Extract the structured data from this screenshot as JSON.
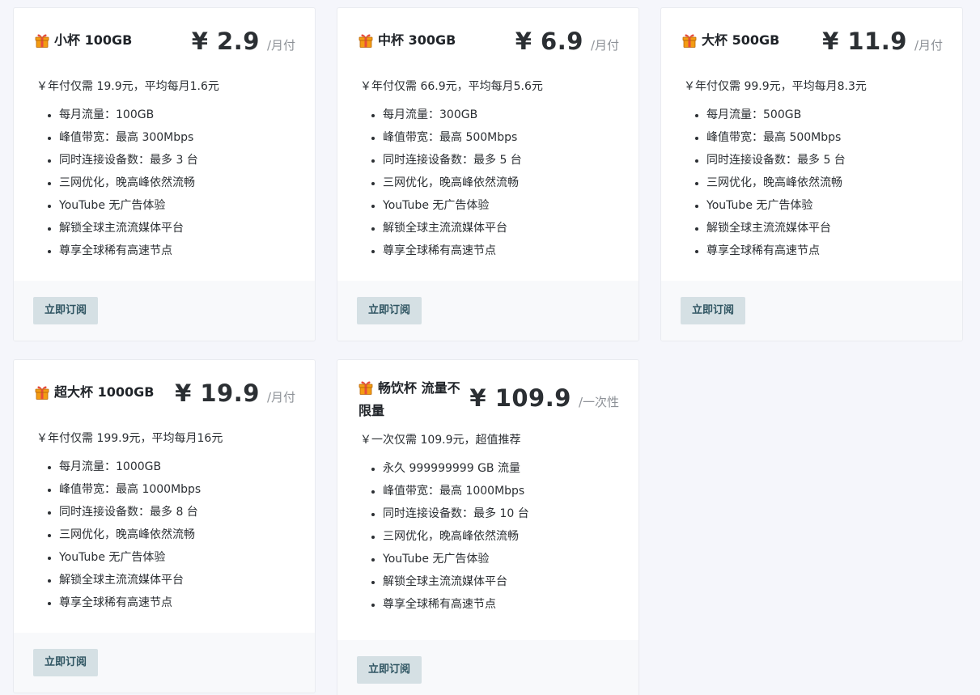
{
  "plans": [
    {
      "name": "小杯 100GB",
      "price": "¥ 2.9",
      "unit": "/月付",
      "summary": "￥年付仅需 19.9元，平均每月1.6元",
      "features": [
        "每月流量：100GB",
        "峰值带宽：最高 300Mbps",
        "同时连接设备数：最多 3 台",
        "三网优化，晚高峰依然流畅",
        "YouTube 无广告体验",
        "解锁全球主流流媒体平台",
        "尊享全球稀有高速节点"
      ],
      "button": "立即订阅"
    },
    {
      "name": "中杯 300GB",
      "price": "¥ 6.9",
      "unit": "/月付",
      "summary": "￥年付仅需 66.9元，平均每月5.6元",
      "features": [
        "每月流量：300GB",
        "峰值带宽：最高 500Mbps",
        "同时连接设备数：最多 5 台",
        "三网优化，晚高峰依然流畅",
        "YouTube 无广告体验",
        "解锁全球主流流媒体平台",
        "尊享全球稀有高速节点"
      ],
      "button": "立即订阅"
    },
    {
      "name": "大杯 500GB",
      "price": "¥ 11.9",
      "unit": "/月付",
      "summary": "￥年付仅需 99.9元，平均每月8.3元",
      "features": [
        "每月流量：500GB",
        "峰值带宽：最高 500Mbps",
        "同时连接设备数：最多 5 台",
        "三网优化，晚高峰依然流畅",
        "YouTube 无广告体验",
        "解锁全球主流流媒体平台",
        "尊享全球稀有高速节点"
      ],
      "button": "立即订阅"
    },
    {
      "name": "超大杯 1000GB",
      "price": "¥ 19.9",
      "unit": "/月付",
      "summary": "￥年付仅需 199.9元，平均每月16元",
      "features": [
        "每月流量：1000GB",
        "峰值带宽：最高 1000Mbps",
        "同时连接设备数：最多 8 台",
        "三网优化，晚高峰依然流畅",
        "YouTube 无广告体验",
        "解锁全球主流流媒体平台",
        "尊享全球稀有高速节点"
      ],
      "button": "立即订阅"
    },
    {
      "name": "畅饮杯 流量不限量",
      "price": "¥ 109.9",
      "unit": "/一次性",
      "summary": "￥一次仅需 109.9元，超值推荐",
      "features": [
        "永久 999999999 GB 流量",
        "峰值带宽：最高 1000Mbps",
        "同时连接设备数：最多 10 台",
        "三网优化，晚高峰依然流畅",
        "YouTube 无广告体验",
        "解锁全球主流流媒体平台",
        "尊享全球稀有高速节点"
      ],
      "button": "立即订阅"
    }
  ],
  "icons": {
    "plan_icon": "gift-icon"
  },
  "colors": {
    "gift": "#f39c12",
    "ribbon": "#e74c3c",
    "button_bg": "#d5e0e4",
    "button_text": "#2f5562"
  }
}
